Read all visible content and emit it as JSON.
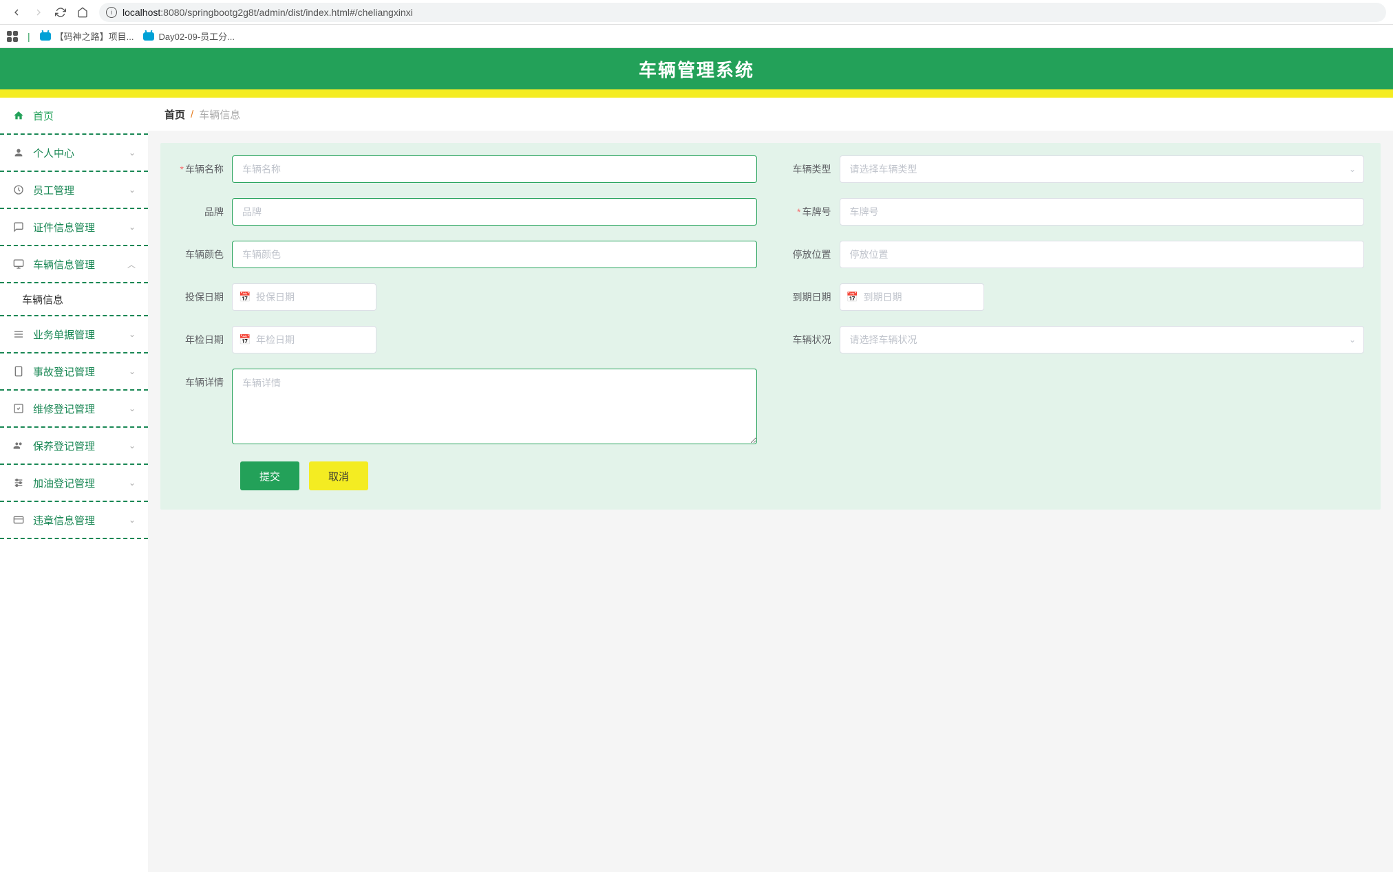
{
  "browser": {
    "url_host": "localhost",
    "url_path": ":8080/springbootg2g8t/admin/dist/index.html#/cheliangxinxi",
    "bookmarks": [
      "【码神之路】项目...",
      "Day02-09-员工分..."
    ]
  },
  "banner": {
    "title": "车辆管理系统"
  },
  "sidebar": {
    "items": [
      {
        "label": "首页",
        "icon": "home",
        "expandable": false
      },
      {
        "label": "个人中心",
        "icon": "user",
        "expandable": true
      },
      {
        "label": "员工管理",
        "icon": "clock",
        "expandable": true
      },
      {
        "label": "证件信息管理",
        "icon": "chat",
        "expandable": true
      },
      {
        "label": "车辆信息管理",
        "icon": "monitor",
        "expandable": true,
        "expanded": true,
        "children": [
          "车辆信息"
        ]
      },
      {
        "label": "业务单据管理",
        "icon": "list",
        "expandable": true
      },
      {
        "label": "事故登记管理",
        "icon": "phone",
        "expandable": true
      },
      {
        "label": "维修登记管理",
        "icon": "check",
        "expandable": true
      },
      {
        "label": "保养登记管理",
        "icon": "users",
        "expandable": true
      },
      {
        "label": "加油登记管理",
        "icon": "opts",
        "expandable": true
      },
      {
        "label": "违章信息管理",
        "icon": "card",
        "expandable": true
      }
    ]
  },
  "breadcrumb": {
    "home": "首页",
    "current": "车辆信息"
  },
  "form": {
    "fields": {
      "name": {
        "label": "车辆名称",
        "placeholder": "车辆名称",
        "required": true
      },
      "type": {
        "label": "车辆类型",
        "placeholder": "请选择车辆类型"
      },
      "brand": {
        "label": "品牌",
        "placeholder": "品牌"
      },
      "plate": {
        "label": "车牌号",
        "placeholder": "车牌号",
        "required": true
      },
      "color": {
        "label": "车辆颜色",
        "placeholder": "车辆颜色"
      },
      "park": {
        "label": "停放位置",
        "placeholder": "停放位置"
      },
      "insure_date": {
        "label": "投保日期",
        "placeholder": "投保日期"
      },
      "expire_date": {
        "label": "到期日期",
        "placeholder": "到期日期"
      },
      "inspect_date": {
        "label": "年检日期",
        "placeholder": "年检日期"
      },
      "status": {
        "label": "车辆状况",
        "placeholder": "请选择车辆状况"
      },
      "detail": {
        "label": "车辆详情",
        "placeholder": "车辆详情"
      }
    },
    "buttons": {
      "submit": "提交",
      "cancel": "取消"
    }
  }
}
